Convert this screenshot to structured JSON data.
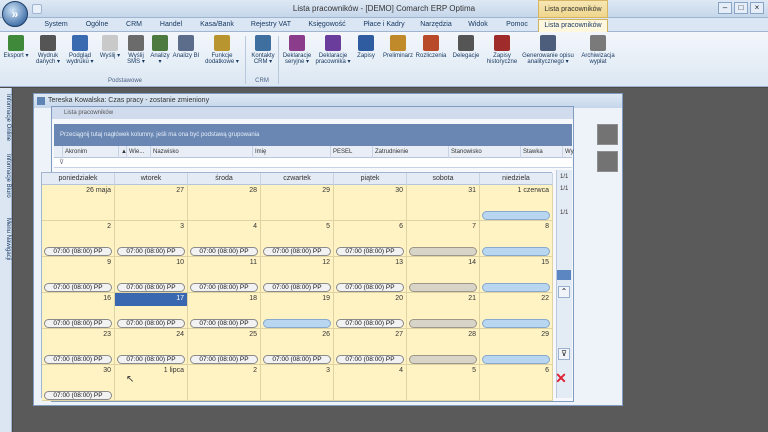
{
  "window": {
    "title": "Lista pracowników - [DEMO] Comarch ERP Optima",
    "context_tab_header": "Lista pracowników"
  },
  "menu": {
    "tabs": [
      "System",
      "Ogólne",
      "CRM",
      "Handel",
      "Kasa/Bank",
      "Rejestry VAT",
      "Księgowość",
      "Płace i Kadry",
      "Narzędzia",
      "Widok",
      "Pomoc",
      "Lista pracowników"
    ]
  },
  "ribbon": {
    "buttons": [
      {
        "label": "Eksport",
        "sub": "▾",
        "color": "#3f8a3a"
      },
      {
        "label": "Wydruk danych",
        "sub": "▾",
        "color": "#555"
      },
      {
        "label": "Podgląd wydruku",
        "sub": "▾",
        "color": "#3a6ab0"
      },
      {
        "label": "Wyślij",
        "sub": "▾",
        "color": "#c9c9c9"
      },
      {
        "label": "Wyślij SMS",
        "sub": "▾",
        "color": "#6b6b6b"
      },
      {
        "label": "Analizy",
        "sub": "▾",
        "color": "#4c7a3f"
      },
      {
        "label": "Analizy BI",
        "sub": "",
        "color": "#5b6d8a"
      },
      {
        "label": "Funkcje dodatkowe",
        "sub": "▾",
        "color": "#b8952e"
      },
      {
        "label": "Kontakty CRM",
        "sub": "▾",
        "color": "#3f6f9e"
      },
      {
        "label": "Deklaracje seryjne",
        "sub": "▾",
        "color": "#8b3c8b"
      },
      {
        "label": "Deklaracje pracownika",
        "sub": "▾",
        "color": "#6a3c9b"
      },
      {
        "label": "Zapisy",
        "sub": "",
        "color": "#2f5ba0"
      },
      {
        "label": "Preliminarz",
        "sub": "",
        "color": "#c08a2a"
      },
      {
        "label": "Rozliczenia",
        "sub": "",
        "color": "#b84a2a"
      },
      {
        "label": "Delegacje",
        "sub": "",
        "color": "#555"
      },
      {
        "label": "Zapisy historyczne",
        "sub": "",
        "color": "#a02b2b"
      },
      {
        "label": "Generowanie opisu analitycznego",
        "sub": "▾",
        "color": "#4d5e7c"
      },
      {
        "label": "Archiwizacja wypłat",
        "sub": "",
        "color": "#7a7a7a"
      }
    ],
    "group_podstawowe": "Podstawowe",
    "group_crm": "CRM"
  },
  "leftpane": {
    "tabs": [
      "Informacje Online",
      "Informacje Biuro",
      "Menu Nawigacji"
    ]
  },
  "child_window": {
    "title": "Tereska Kowalska: Czas pracy - zostanie zmieniony"
  },
  "inner_window": {
    "title": "Lista pracowników",
    "group_hint": "Przeciągnij tutaj nagłówek kolumny, jeśli ma ona być podstawą grupowania",
    "columns": [
      "Akronim",
      "▲",
      "Wie...",
      "Nazwisko",
      "Imię",
      "PESEL",
      "Zatrudnienie",
      "Stanowisko",
      "Stawka",
      "Wy"
    ],
    "right_numbers": [
      "1/1",
      "1/1",
      "1/1"
    ]
  },
  "calendar": {
    "weekdays": [
      "poniedziałek",
      "wtorek",
      "środa",
      "czwartek",
      "piątek",
      "sobota",
      "niedziela"
    ],
    "weeks": [
      [
        {
          "d": "26 maja",
          "p": "",
          "t": "none"
        },
        {
          "d": "27",
          "p": "",
          "t": "none"
        },
        {
          "d": "28",
          "p": "",
          "t": "none"
        },
        {
          "d": "29",
          "p": "",
          "t": "none"
        },
        {
          "d": "30",
          "p": "",
          "t": "none"
        },
        {
          "d": "31",
          "p": "",
          "t": "none"
        },
        {
          "d": "1 czerwca",
          "p": "",
          "t": "blue"
        }
      ],
      [
        {
          "d": "2",
          "p": "07:00 (08:00) PP",
          "t": "work"
        },
        {
          "d": "3",
          "p": "07:00 (08:00) PP",
          "t": "work"
        },
        {
          "d": "4",
          "p": "07:00 (08:00) PP",
          "t": "work"
        },
        {
          "d": "5",
          "p": "07:00 (08:00) PP",
          "t": "work"
        },
        {
          "d": "6",
          "p": "07:00 (08:00) PP",
          "t": "work"
        },
        {
          "d": "7",
          "p": "",
          "t": "grey"
        },
        {
          "d": "8",
          "p": "",
          "t": "blue"
        }
      ],
      [
        {
          "d": "9",
          "p": "07:00 (08:00) PP",
          "t": "work"
        },
        {
          "d": "10",
          "p": "07:00 (08:00) PP",
          "t": "work"
        },
        {
          "d": "11",
          "p": "07:00 (08:00) PP",
          "t": "work"
        },
        {
          "d": "12",
          "p": "07:00 (08:00) PP",
          "t": "work"
        },
        {
          "d": "13",
          "p": "07:00 (08:00) PP",
          "t": "work"
        },
        {
          "d": "14",
          "p": "",
          "t": "grey"
        },
        {
          "d": "15",
          "p": "",
          "t": "blue"
        }
      ],
      [
        {
          "d": "16",
          "p": "07:00 (08:00) PP",
          "t": "work"
        },
        {
          "d": "17",
          "p": "07:00 (08:00) PP",
          "t": "work",
          "sel": true
        },
        {
          "d": "18",
          "p": "07:00 (08:00) PP",
          "t": "work"
        },
        {
          "d": "19",
          "p": "",
          "t": "blue"
        },
        {
          "d": "20",
          "p": "07:00 (08:00) PP",
          "t": "work"
        },
        {
          "d": "21",
          "p": "",
          "t": "grey"
        },
        {
          "d": "22",
          "p": "",
          "t": "blue"
        }
      ],
      [
        {
          "d": "23",
          "p": "07:00 (08:00) PP",
          "t": "work"
        },
        {
          "d": "24",
          "p": "07:00 (08:00) PP",
          "t": "work"
        },
        {
          "d": "25",
          "p": "07:00 (08:00) PP",
          "t": "work"
        },
        {
          "d": "26",
          "p": "07:00 (08:00) PP",
          "t": "work"
        },
        {
          "d": "27",
          "p": "07:00 (08:00) PP",
          "t": "work"
        },
        {
          "d": "28",
          "p": "",
          "t": "grey"
        },
        {
          "d": "29",
          "p": "",
          "t": "blue"
        }
      ],
      [
        {
          "d": "30",
          "p": "07:00 (08:00) PP",
          "t": "work"
        },
        {
          "d": "1 lipca",
          "p": "",
          "t": "none"
        },
        {
          "d": "2",
          "p": "",
          "t": "none"
        },
        {
          "d": "3",
          "p": "",
          "t": "none"
        },
        {
          "d": "4",
          "p": "",
          "t": "none"
        },
        {
          "d": "5",
          "p": "",
          "t": "none"
        },
        {
          "d": "6",
          "p": "",
          "t": "none"
        }
      ]
    ]
  }
}
